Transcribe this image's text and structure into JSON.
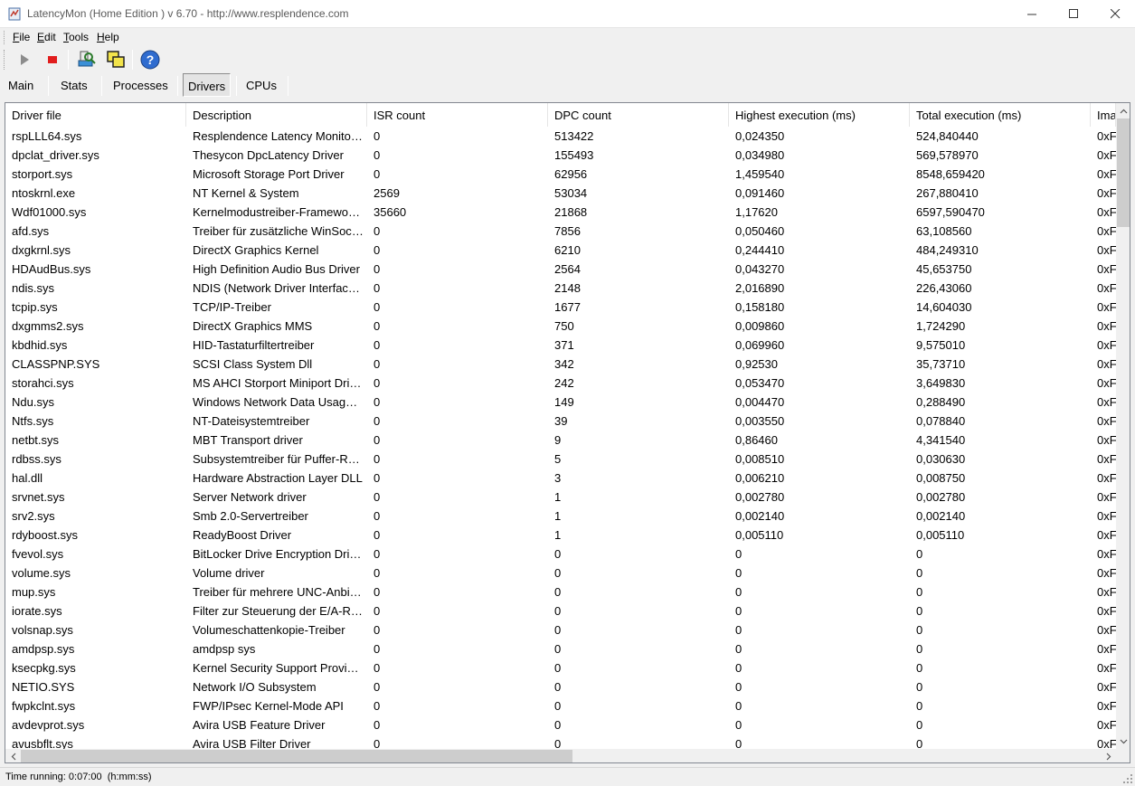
{
  "window": {
    "title": "LatencyMon  (Home Edition )  v 6.70 - http://www.resplendence.com",
    "icon": "latencymon-app-icon"
  },
  "menu": [
    {
      "label": "File",
      "mnemonic": "F",
      "rest": "ile"
    },
    {
      "label": "Edit",
      "mnemonic": "E",
      "rest": "dit"
    },
    {
      "label": "Tools",
      "mnemonic": "T",
      "rest": "ools"
    },
    {
      "label": "Help",
      "mnemonic": "H",
      "rest": "elp"
    }
  ],
  "toolbar": {
    "icons": [
      "play-icon",
      "stop-icon",
      "driver-scan-icon",
      "windows-icon",
      "help-icon"
    ]
  },
  "tabs": [
    {
      "label": "Main",
      "active": false
    },
    {
      "label": "Stats",
      "active": false
    },
    {
      "label": "Processes",
      "active": false
    },
    {
      "label": "Drivers",
      "active": true
    },
    {
      "label": "CPUs",
      "active": false
    }
  ],
  "table": {
    "columns": [
      "Driver file",
      "Description",
      "ISR count",
      "DPC count",
      "Highest execution (ms)",
      "Total execution (ms)",
      "Ima"
    ],
    "rows": [
      [
        "rspLLL64.sys",
        "Resplendence Latency Monitoring and Auxiliary Kernel Library",
        "0",
        "513422",
        "0,024350",
        "524,840440",
        "0xF"
      ],
      [
        "dpclat_driver.sys",
        "Thesycon DpcLatency Driver",
        "0",
        "155493",
        "0,034980",
        "569,578970",
        "0xF"
      ],
      [
        "storport.sys",
        "Microsoft Storage Port Driver",
        "0",
        "62956",
        "1,459540",
        "8548,659420",
        "0xF"
      ],
      [
        "ntoskrnl.exe",
        "NT Kernel & System",
        "2569",
        "53034",
        "0,091460",
        "267,880410",
        "0xF"
      ],
      [
        "Wdf01000.sys",
        "Kernelmodustreiber-Framework-Laufzeit",
        "35660",
        "21868",
        "1,17620",
        "6597,590470",
        "0xF"
      ],
      [
        "afd.sys",
        "Treiber für zusätzliche WinSock-Funktionen",
        "0",
        "7856",
        "0,050460",
        "63,108560",
        "0xF"
      ],
      [
        "dxgkrnl.sys",
        "DirectX Graphics Kernel",
        "0",
        "6210",
        "0,244410",
        "484,249310",
        "0xF"
      ],
      [
        "HDAudBus.sys",
        "High Definition Audio Bus Driver",
        "0",
        "2564",
        "0,043270",
        "45,653750",
        "0xF"
      ],
      [
        "ndis.sys",
        "NDIS (Network Driver Interface Specification)",
        "0",
        "2148",
        "2,016890",
        "226,43060",
        "0xF"
      ],
      [
        "tcpip.sys",
        "TCP/IP-Treiber",
        "0",
        "1677",
        "0,158180",
        "14,604030",
        "0xF"
      ],
      [
        "dxgmms2.sys",
        "DirectX Graphics MMS",
        "0",
        "750",
        "0,009860",
        "1,724290",
        "0xF"
      ],
      [
        "kbdhid.sys",
        "HID-Tastaturfiltertreiber",
        "0",
        "371",
        "0,069960",
        "9,575010",
        "0xF"
      ],
      [
        "CLASSPNP.SYS",
        "SCSI Class System Dll",
        "0",
        "342",
        "0,92530",
        "35,73710",
        "0xF"
      ],
      [
        "storahci.sys",
        "MS AHCI Storport Miniport Driver",
        "0",
        "242",
        "0,053470",
        "3,649830",
        "0xF"
      ],
      [
        "Ndu.sys",
        "Windows Network Data Usage Monitoring Driver",
        "0",
        "149",
        "0,004470",
        "0,288490",
        "0xF"
      ],
      [
        "Ntfs.sys",
        "NT-Dateisystemtreiber",
        "0",
        "39",
        "0,003550",
        "0,078840",
        "0xF"
      ],
      [
        "netbt.sys",
        "MBT Transport driver",
        "0",
        "9",
        "0,86460",
        "4,341540",
        "0xF"
      ],
      [
        "rdbss.sys",
        "Subsystemtreiber für Puffer-Redirector",
        "0",
        "5",
        "0,008510",
        "0,030630",
        "0xF"
      ],
      [
        "hal.dll",
        "Hardware Abstraction Layer DLL",
        "0",
        "3",
        "0,006210",
        "0,008750",
        "0xF"
      ],
      [
        "srvnet.sys",
        "Server Network driver",
        "0",
        "1",
        "0,002780",
        "0,002780",
        "0xF"
      ],
      [
        "srv2.sys",
        "Smb 2.0-Servertreiber",
        "0",
        "1",
        "0,002140",
        "0,002140",
        "0xF"
      ],
      [
        "rdyboost.sys",
        "ReadyBoost Driver",
        "0",
        "1",
        "0,005110",
        "0,005110",
        "0xF"
      ],
      [
        "fvevol.sys",
        "BitLocker Drive Encryption Driver",
        "0",
        "0",
        "0",
        "0",
        "0xF"
      ],
      [
        "volume.sys",
        "Volume driver",
        "0",
        "0",
        "0",
        "0",
        "0xF"
      ],
      [
        "mup.sys",
        "Treiber für mehrere UNC-Anbieter",
        "0",
        "0",
        "0",
        "0",
        "0xF"
      ],
      [
        "iorate.sys",
        "Filter zur Steuerung der E/A-Rate",
        "0",
        "0",
        "0",
        "0",
        "0xF"
      ],
      [
        "volsnap.sys",
        "Volumeschattenkopie-Treiber",
        "0",
        "0",
        "0",
        "0",
        "0xF"
      ],
      [
        "amdpsp.sys",
        "amdpsp sys",
        "0",
        "0",
        "0",
        "0",
        "0xF"
      ],
      [
        "ksecpkg.sys",
        "Kernel Security Support Provider Interface Packages",
        "0",
        "0",
        "0",
        "0",
        "0xF"
      ],
      [
        "NETIO.SYS",
        "Network I/O Subsystem",
        "0",
        "0",
        "0",
        "0",
        "0xF"
      ],
      [
        "fwpkclnt.sys",
        "FWP/IPsec Kernel-Mode API",
        "0",
        "0",
        "0",
        "0",
        "0xF"
      ],
      [
        "avdevprot.sys",
        "Avira USB Feature Driver",
        "0",
        "0",
        "0",
        "0",
        "0xF"
      ],
      [
        "avusbflt.sys",
        "Avira USB Filter Driver",
        "0",
        "0",
        "0",
        "0",
        "0xF"
      ]
    ]
  },
  "status": {
    "text": "Time running: 0:07:00  (h:mm:ss)"
  }
}
